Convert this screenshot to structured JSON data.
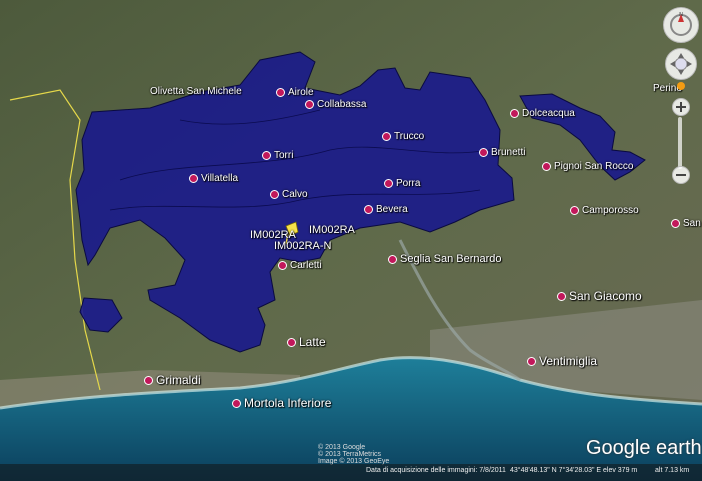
{
  "map": {
    "places": {
      "airole": "Airole",
      "collabassa": "Collabassa",
      "trucco": "Trucco",
      "dolceacqua": "Dolceacqua",
      "torri": "Torri",
      "brunetti": "Brunetti",
      "villatella": "Villatella",
      "calvo": "Calvo",
      "porra": "Porra",
      "bevera": "Bevera",
      "pignoi": "Pignoi San Rocco",
      "camporosso": "Camporosso",
      "carletti": "Carletti",
      "seglia": "Seglia San Bernardo",
      "san_giacomo": "San Giacomo",
      "latte": "Latte",
      "ventimiglia": "Ventimiglia",
      "grimaldi": "Grimaldi",
      "mortola": "Mortola Inferiore",
      "olivetta": "Olivetta San Michele",
      "perino": "Perino",
      "san_bi": "San Bia"
    },
    "markers": {
      "label_a": "IM002RA",
      "label_b": "IM002RA",
      "label_c": "IM002RA-N"
    }
  },
  "credits": {
    "line1": "© 2013 Google",
    "line2": "© 2013 TerraMetrics",
    "line3": "Image © 2013 GeoEye"
  },
  "brand": {
    "logo": "Google earth"
  },
  "status": {
    "date": "Data di acquisizione delle immagini: 7/8/2011",
    "coords": "43°48'48.13\" N   7°34'28.03\" E",
    "elev": "elev   379 m",
    "eye": "alt   7.13 km"
  }
}
